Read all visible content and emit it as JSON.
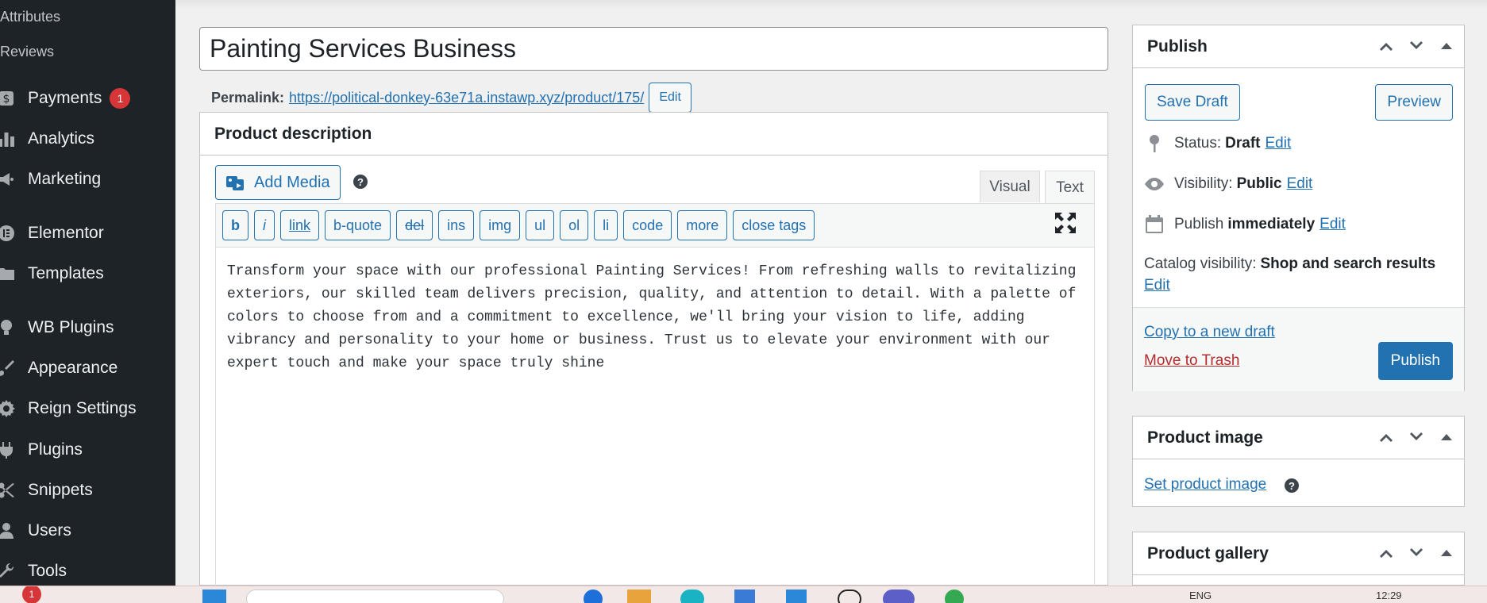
{
  "sidebar": {
    "sub_items": [
      "Attributes",
      "Reviews"
    ],
    "items": [
      {
        "label": "Payments",
        "icon": "payments-icon",
        "badge": "1"
      },
      {
        "label": "Analytics",
        "icon": "analytics-icon"
      },
      {
        "label": "Marketing",
        "icon": "megaphone-icon"
      },
      {
        "label": "Elementor",
        "icon": "elementor-icon"
      },
      {
        "label": "Templates",
        "icon": "folder-icon"
      },
      {
        "label": "WB Plugins",
        "icon": "lightbulb-icon"
      },
      {
        "label": "Appearance",
        "icon": "paintbrush-icon"
      },
      {
        "label": "Reign Settings",
        "icon": "gear-icon"
      },
      {
        "label": "Plugins",
        "icon": "plugin-icon"
      },
      {
        "label": "Snippets",
        "icon": "scissors-icon"
      },
      {
        "label": "Users",
        "icon": "user-icon"
      },
      {
        "label": "Tools",
        "icon": "wrench-icon"
      }
    ]
  },
  "post": {
    "title": "Painting Services Business",
    "permalink_label": "Permalink:",
    "permalink_url": "https://political-donkey-63e71a.instawp.xyz/product/175/",
    "permalink_edit": "Edit"
  },
  "editor": {
    "heading": "Product description",
    "add_media": "Add Media",
    "help": "?",
    "tab_visual": "Visual",
    "tab_text": "Text",
    "quicktags": [
      "b",
      "i",
      "link",
      "b-quote",
      "del",
      "ins",
      "img",
      "ul",
      "ol",
      "li",
      "code",
      "more",
      "close tags"
    ],
    "content": "Transform your space with our professional Painting Services! From refreshing walls to revitalizing exteriors, our skilled team delivers precision, quality, and attention to detail. With a palette of colors to choose from and a commitment to excellence, we'll bring your vision to life, adding vibrancy and personality to your home or business. Trust us to elevate your environment with our expert touch and make your space truly shine"
  },
  "publish": {
    "heading": "Publish",
    "save_draft": "Save Draft",
    "preview": "Preview",
    "status_label": "Status:",
    "status_value": "Draft",
    "visibility_label": "Visibility:",
    "visibility_value": "Public",
    "publish_label": "Publish",
    "publish_value": "immediately",
    "catalog_label": "Catalog visibility:",
    "catalog_value": "Shop and search results",
    "edit": "Edit",
    "copy_draft": "Copy to a new draft",
    "trash": "Move to Trash",
    "publish_button": "Publish"
  },
  "product_image": {
    "heading": "Product image",
    "set_image": "Set product image",
    "help": "?"
  },
  "product_gallery": {
    "heading": "Product gallery"
  },
  "taskbar": {
    "notification_badge": "1",
    "lang": "ENG",
    "time": "12:29"
  },
  "colors": {
    "accent": "#2271b1",
    "sidebar_bg": "#1d2327",
    "danger": "#d63638",
    "trash": "#b32d2e"
  }
}
